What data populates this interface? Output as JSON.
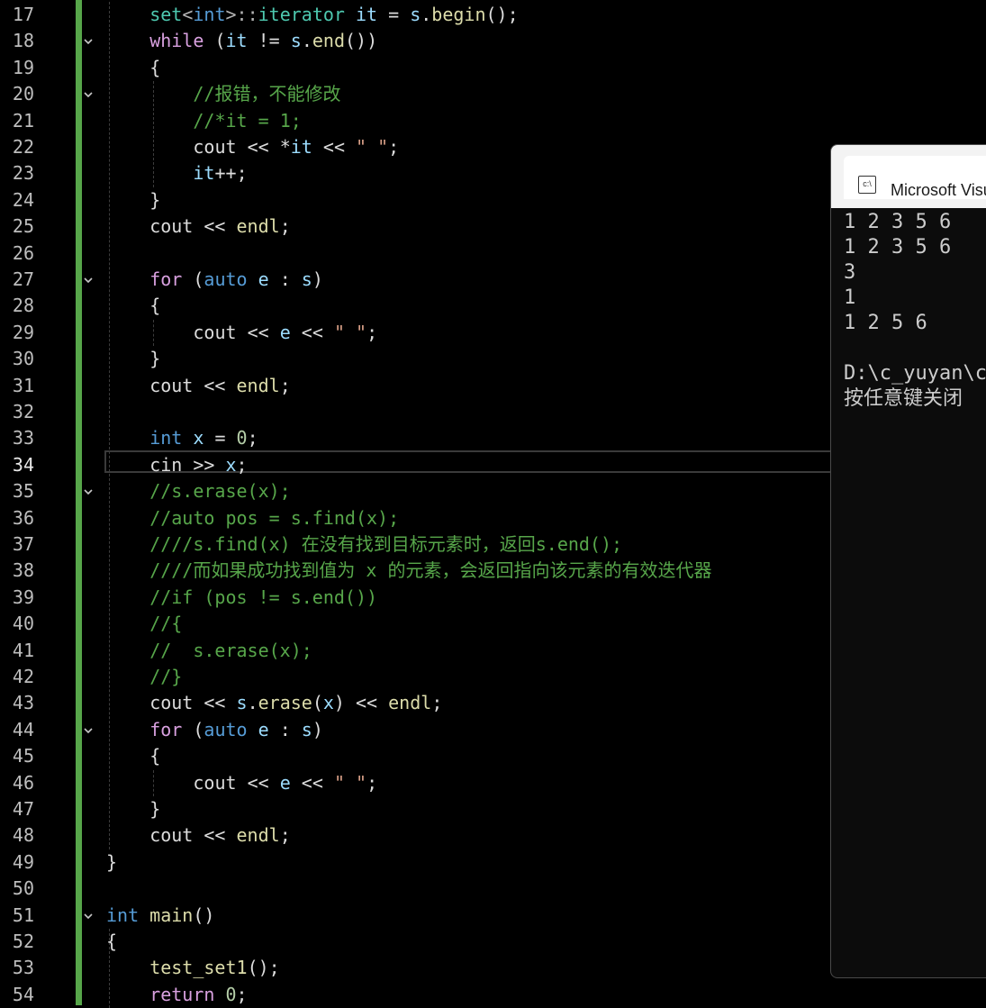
{
  "editor": {
    "current_line": "34",
    "line_numbers": [
      "17",
      "18",
      "19",
      "20",
      "21",
      "22",
      "23",
      "24",
      "25",
      "26",
      "27",
      "28",
      "29",
      "30",
      "31",
      "32",
      "33",
      "34",
      "35",
      "36",
      "37",
      "38",
      "39",
      "40",
      "41",
      "42",
      "43",
      "44",
      "45",
      "46",
      "47",
      "48",
      "49",
      "50",
      "51",
      "52",
      "53",
      "54"
    ],
    "lines": [
      {
        "t": [
          [
            "ty",
            "set"
          ],
          [
            "op",
            "<"
          ],
          [
            "kw",
            "int"
          ],
          [
            "op",
            ">::"
          ],
          [
            "ty",
            "iterator"
          ],
          [
            "",
            " "
          ],
          [
            "var",
            "it"
          ],
          [
            "",
            " = "
          ],
          [
            "var",
            "s"
          ],
          [
            "",
            "."
          ],
          [
            "fn",
            "begin"
          ],
          [
            "",
            "();"
          ]
        ]
      },
      {
        "t": [
          [
            "ctl",
            "while"
          ],
          [
            "",
            " ("
          ],
          [
            "var",
            "it"
          ],
          [
            "",
            " != "
          ],
          [
            "var",
            "s"
          ],
          [
            "",
            "."
          ],
          [
            "fn",
            "end"
          ],
          [
            "",
            "())"
          ]
        ]
      },
      {
        "t": [
          [
            "",
            "{"
          ]
        ]
      },
      {
        "t": [
          [
            "cm",
            "//报错，不能修改"
          ]
        ]
      },
      {
        "t": [
          [
            "cm",
            "//*it = 1;"
          ]
        ]
      },
      {
        "t": [
          [
            "",
            "cout << *"
          ],
          [
            "var",
            "it"
          ],
          [
            "",
            " << "
          ],
          [
            "str",
            "\" \""
          ],
          [
            "",
            ";"
          ]
        ]
      },
      {
        "t": [
          [
            "var",
            "it"
          ],
          [
            "",
            "++;"
          ]
        ]
      },
      {
        "t": [
          [
            "",
            "}"
          ]
        ]
      },
      {
        "t": [
          [
            "",
            "cout << "
          ],
          [
            "fn",
            "endl"
          ],
          [
            "",
            ";"
          ]
        ]
      },
      {
        "t": [
          [
            "",
            ""
          ]
        ]
      },
      {
        "t": [
          [
            "ctl",
            "for"
          ],
          [
            "",
            " ("
          ],
          [
            "kw",
            "auto"
          ],
          [
            "",
            " "
          ],
          [
            "var",
            "e"
          ],
          [
            "",
            " : "
          ],
          [
            "var",
            "s"
          ],
          [
            "",
            ")"
          ]
        ]
      },
      {
        "t": [
          [
            "",
            "{"
          ]
        ]
      },
      {
        "t": [
          [
            "",
            "cout << "
          ],
          [
            "var",
            "e"
          ],
          [
            "",
            " << "
          ],
          [
            "str",
            "\" \""
          ],
          [
            "",
            ";"
          ]
        ]
      },
      {
        "t": [
          [
            "",
            "}"
          ]
        ]
      },
      {
        "t": [
          [
            "",
            "cout << "
          ],
          [
            "fn",
            "endl"
          ],
          [
            "",
            ";"
          ]
        ]
      },
      {
        "t": [
          [
            "",
            ""
          ]
        ]
      },
      {
        "t": [
          [
            "kw",
            "int"
          ],
          [
            "",
            " "
          ],
          [
            "var",
            "x"
          ],
          [
            "",
            " = "
          ],
          [
            "num",
            "0"
          ],
          [
            "",
            ";"
          ]
        ]
      },
      {
        "t": [
          [
            "",
            "cin >> "
          ],
          [
            "var",
            "x"
          ],
          [
            "",
            ";"
          ]
        ]
      },
      {
        "t": [
          [
            "cm",
            "//s.erase(x);"
          ]
        ]
      },
      {
        "t": [
          [
            "cm",
            "//auto pos = s.find(x);"
          ]
        ]
      },
      {
        "t": [
          [
            "cm",
            "////s.find(x) 在没有找到目标元素时，返回s.end();"
          ]
        ]
      },
      {
        "t": [
          [
            "cm",
            "////而如果成功找到值为 x 的元素，会返回指向该元素的有效迭代器"
          ]
        ]
      },
      {
        "t": [
          [
            "cm",
            "//if (pos != s.end())"
          ]
        ]
      },
      {
        "t": [
          [
            "cm",
            "//{"
          ]
        ]
      },
      {
        "t": [
          [
            "cm",
            "//  s.erase(x);"
          ]
        ]
      },
      {
        "t": [
          [
            "cm",
            "//}"
          ]
        ]
      },
      {
        "t": [
          [
            "",
            "cout << "
          ],
          [
            "var",
            "s"
          ],
          [
            "",
            "."
          ],
          [
            "fn",
            "erase"
          ],
          [
            "",
            "("
          ],
          [
            "var",
            "x"
          ],
          [
            "",
            ") << "
          ],
          [
            "fn",
            "endl"
          ],
          [
            "",
            ";"
          ]
        ]
      },
      {
        "t": [
          [
            "ctl",
            "for"
          ],
          [
            "",
            " ("
          ],
          [
            "kw",
            "auto"
          ],
          [
            "",
            " "
          ],
          [
            "var",
            "e"
          ],
          [
            "",
            " : "
          ],
          [
            "var",
            "s"
          ],
          [
            "",
            ")"
          ]
        ]
      },
      {
        "t": [
          [
            "",
            "{"
          ]
        ]
      },
      {
        "t": [
          [
            "",
            "cout << "
          ],
          [
            "var",
            "e"
          ],
          [
            "",
            " << "
          ],
          [
            "str",
            "\" \""
          ],
          [
            "",
            ";"
          ]
        ]
      },
      {
        "t": [
          [
            "",
            "}"
          ]
        ]
      },
      {
        "t": [
          [
            "",
            "cout << "
          ],
          [
            "fn",
            "endl"
          ],
          [
            "",
            ";"
          ]
        ]
      },
      {
        "t": [
          [
            "",
            "}"
          ]
        ]
      },
      {
        "t": [
          [
            "",
            ""
          ]
        ]
      },
      {
        "t": [
          [
            "kw",
            "int"
          ],
          [
            "",
            " "
          ],
          [
            "fn",
            "main"
          ],
          [
            "",
            "()"
          ]
        ]
      },
      {
        "t": [
          [
            "",
            "{"
          ]
        ]
      },
      {
        "t": [
          [
            "fn",
            "test_set1"
          ],
          [
            "",
            "();"
          ]
        ]
      },
      {
        "t": [
          [
            "ctl",
            "return"
          ],
          [
            "",
            " "
          ],
          [
            "num",
            "0"
          ],
          [
            "",
            ";"
          ]
        ]
      }
    ]
  },
  "console": {
    "title": "Microsoft Visual Studio 调试控制台",
    "output": [
      "1 2 3 5 6",
      "1 2 3 5 6",
      "3",
      "1",
      "1 2 5 6",
      "",
      "D:\\c_yuyan\\c",
      "按任意键关闭"
    ]
  },
  "colors": {
    "accent": "#57a64a",
    "keyword": "#569cd6",
    "control": "#d8a0df",
    "type": "#4ec9b0",
    "function": "#dcdcaa",
    "variable": "#9cdcfe",
    "comment": "#57a64a"
  }
}
